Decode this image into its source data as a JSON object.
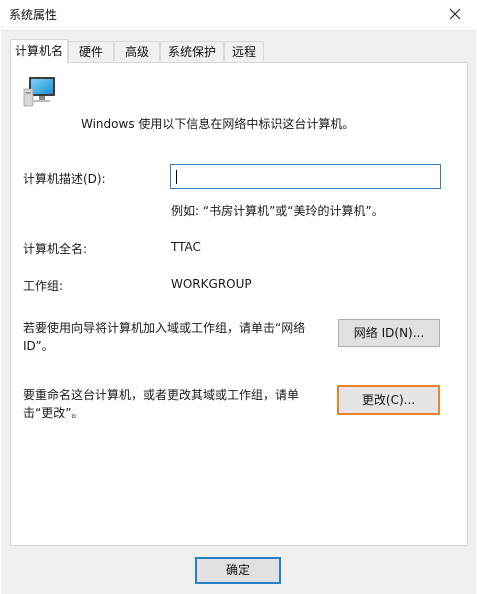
{
  "window": {
    "title": "系统属性"
  },
  "tabs": [
    {
      "label": "计算机名"
    },
    {
      "label": "硬件"
    },
    {
      "label": "高级"
    },
    {
      "label": "系统保护"
    },
    {
      "label": "远程"
    }
  ],
  "computer_name": {
    "intro": "Windows 使用以下信息在网络中标识这台计算机。",
    "description_label": "计算机描述(D):",
    "description_value": "",
    "description_hint": "例如: “书房计算机”或“美玲的计算机”。",
    "full_name_label": "计算机全名:",
    "full_name_value": "TTAC",
    "workgroup_label": "工作组:",
    "workgroup_value": "WORKGROUP",
    "network_text": "若要使用向导将计算机加入域或工作组，请单击“网络 ID”。",
    "network_button": "网络 ID(N)...",
    "rename_text": "要重命名这台计算机，或者更改其域或工作组，请单击“更改”。",
    "change_button": "更改(C)..."
  },
  "footer": {
    "ok_button": "确定"
  },
  "icons": {
    "computer": "computer-icon",
    "close": "close-icon"
  },
  "colors": {
    "focus_border": "#e9852e",
    "accent": "#2a7fc9"
  }
}
